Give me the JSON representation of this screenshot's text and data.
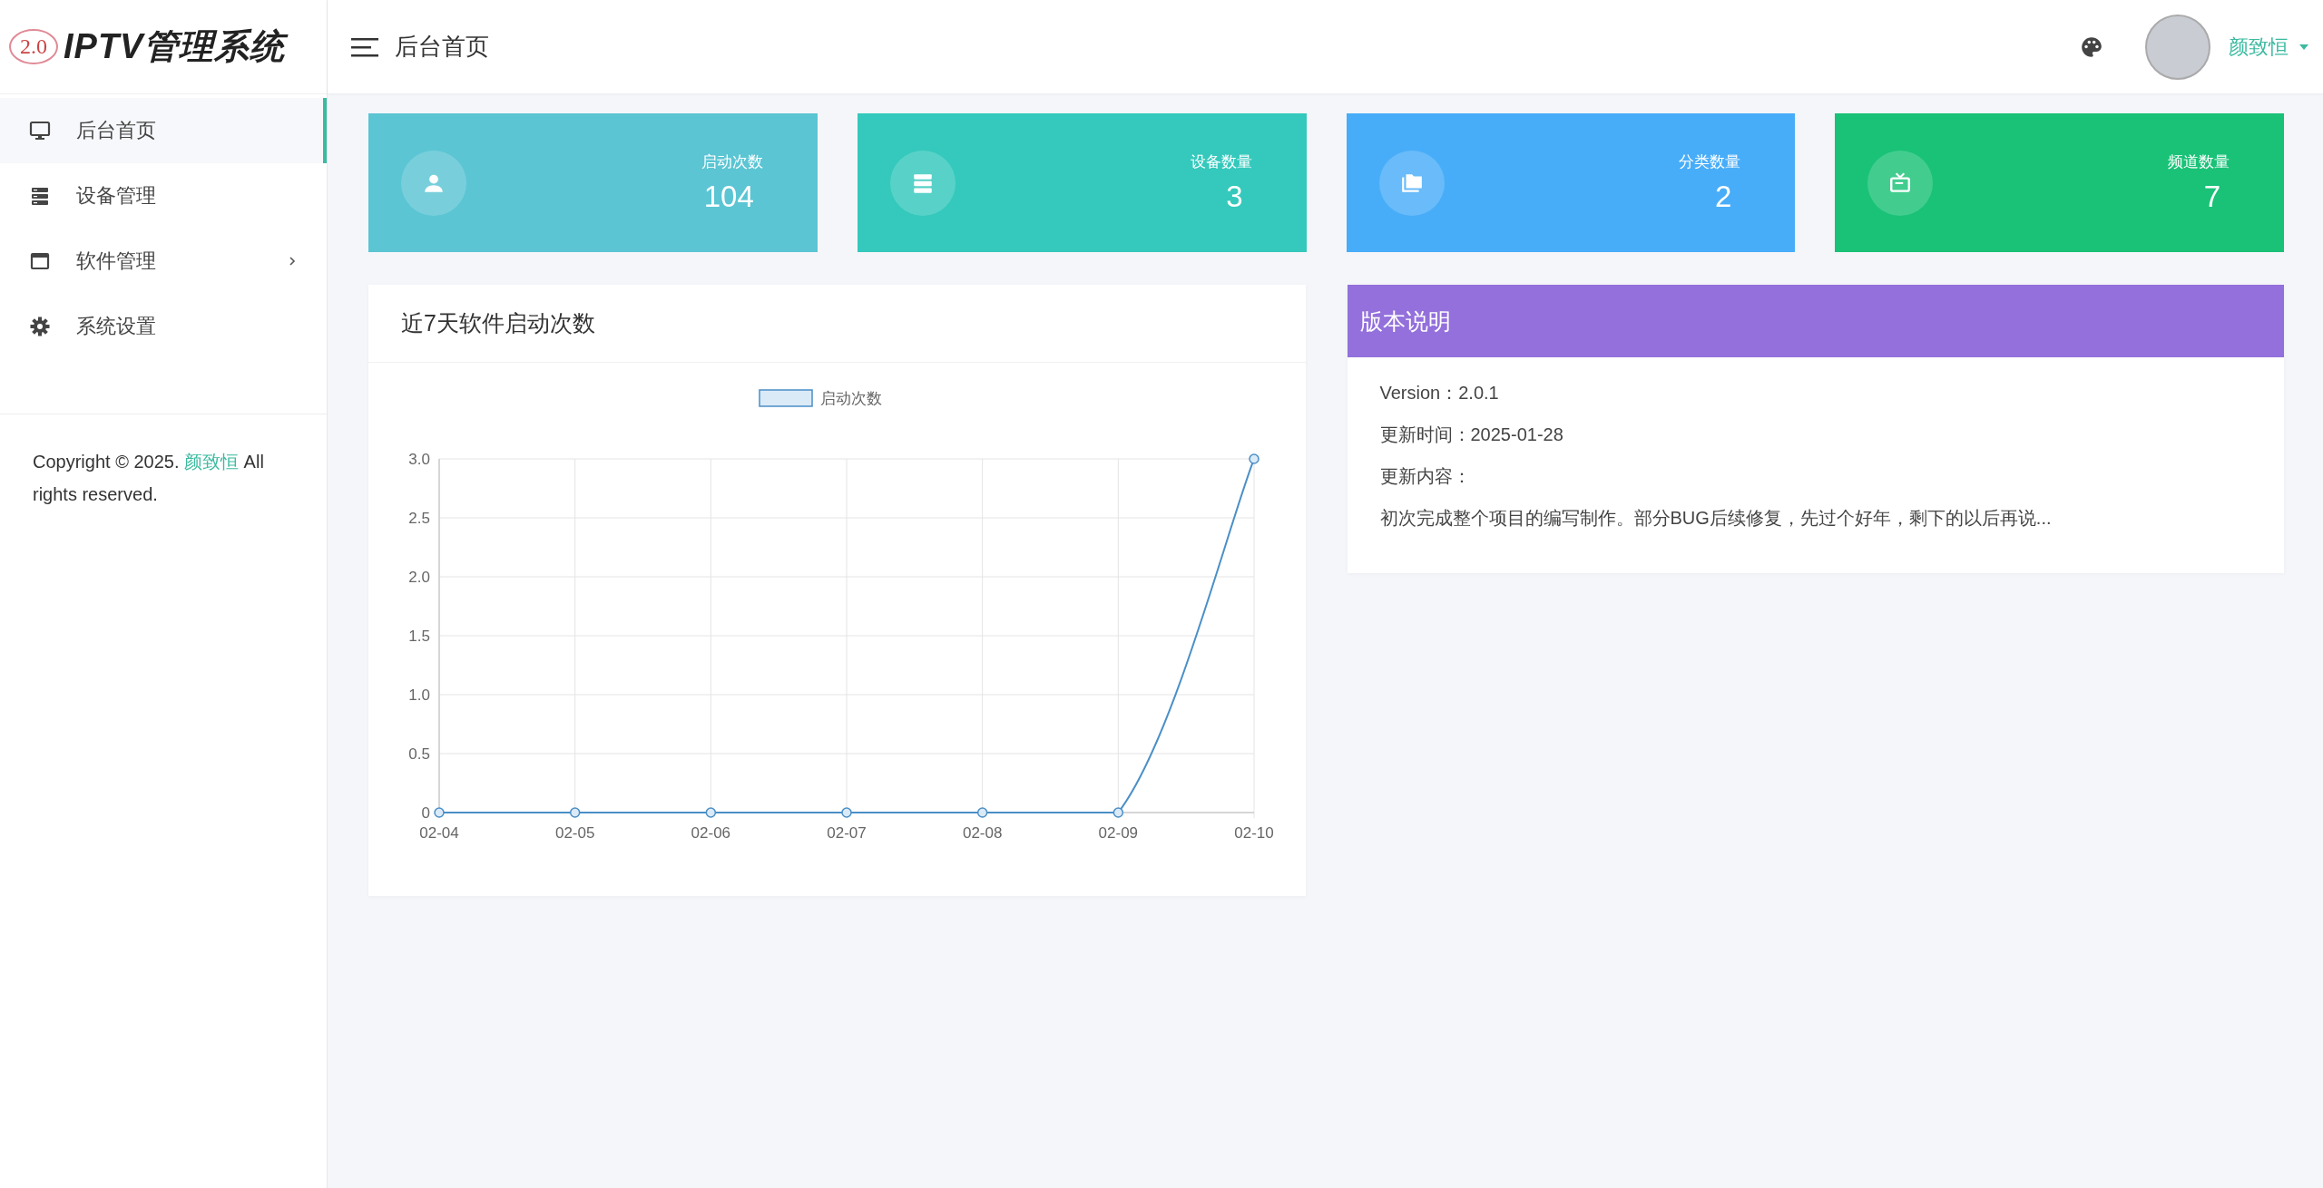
{
  "logo": {
    "badge": "2.0",
    "title": "IPTV管理系统"
  },
  "header": {
    "title": "后台首页",
    "user": "颜致恒"
  },
  "sidebar": {
    "items": [
      {
        "label": "后台首页",
        "selected": true,
        "expandable": false
      },
      {
        "label": "设备管理",
        "selected": false,
        "expandable": false
      },
      {
        "label": "软件管理",
        "selected": false,
        "expandable": true
      },
      {
        "label": "系统设置",
        "selected": false,
        "expandable": false
      }
    ],
    "copyright": {
      "before": "Copyright © 2025.",
      "link": "颜致恒",
      "after": "All rights reserved."
    }
  },
  "stats": [
    {
      "label": "启动次数",
      "value": "104",
      "color": "#5bc5d3"
    },
    {
      "label": "设备数量",
      "value": "3",
      "color": "#34c9bc"
    },
    {
      "label": "分类数量",
      "value": "2",
      "color": "#48adf8"
    },
    {
      "label": "频道数量",
      "value": "7",
      "color": "#19c277"
    }
  ],
  "chart_card": {
    "title": "近7天软件启动次数",
    "chart_data": {
      "type": "line",
      "categories": [
        "02-04",
        "02-05",
        "02-06",
        "02-07",
        "02-08",
        "02-09",
        "02-10"
      ],
      "series": [
        {
          "name": "启动次数",
          "color": "#4a8fc7",
          "marker": true,
          "values": [
            0,
            0,
            0,
            0,
            0,
            0,
            3
          ]
        }
      ],
      "grid": true,
      "ylim": [
        0,
        3
      ],
      "yticks": [
        {
          "value": 0,
          "label": "0"
        },
        {
          "value": 0.5,
          "label": "0.5"
        },
        {
          "value": 1,
          "label": "1.0"
        },
        {
          "value": 1.5,
          "label": "1.5"
        },
        {
          "value": 2,
          "label": "2.0"
        },
        {
          "value": 2.5,
          "label": "2.5"
        },
        {
          "value": 3,
          "label": "3.0"
        }
      ]
    }
  },
  "version_card": {
    "title": "版本说明",
    "lines": [
      "Version：2.0.1",
      "更新时间：2025-01-28",
      "更新内容：",
      "初次完成整个项目的编写制作。部分BUG后续修复，先过个好年，剩下的以后再说..."
    ]
  }
}
